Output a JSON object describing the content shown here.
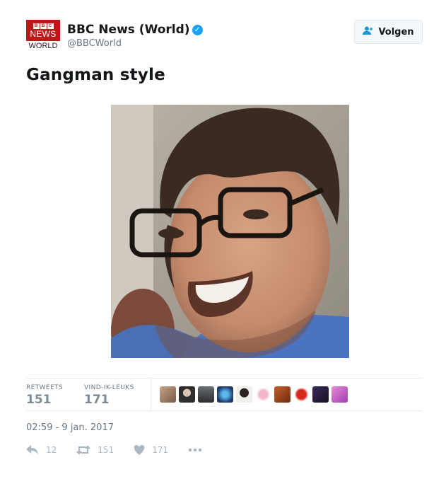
{
  "author": {
    "display_name": "BBC News (World)",
    "handle": "@BBCWorld",
    "verified": true,
    "logo": {
      "blocks": [
        "B",
        "B",
        "C"
      ],
      "line1": "NEWS",
      "line2": "WORLD",
      "color": "#bb1919"
    }
  },
  "follow_button": {
    "label": "Volgen",
    "icon": "follow-person-icon"
  },
  "tweet": {
    "text": "Gangman style",
    "image": "photo-smiling-man-glasses"
  },
  "stats": {
    "retweets_label": "RETWEETS",
    "retweets_value": "151",
    "likes_label": "VIND-IK-LEUKS",
    "likes_value": "171",
    "avatar_count": 10
  },
  "timestamp": "02:59 - 9 jan. 2017",
  "actions": {
    "reply_count": "12",
    "retweet_count": "151",
    "like_count": "171",
    "more_icon": "more-dots-icon"
  },
  "colors": {
    "verified": "#1da1f2",
    "muted": "#657786",
    "icon": "#aab8c2"
  }
}
